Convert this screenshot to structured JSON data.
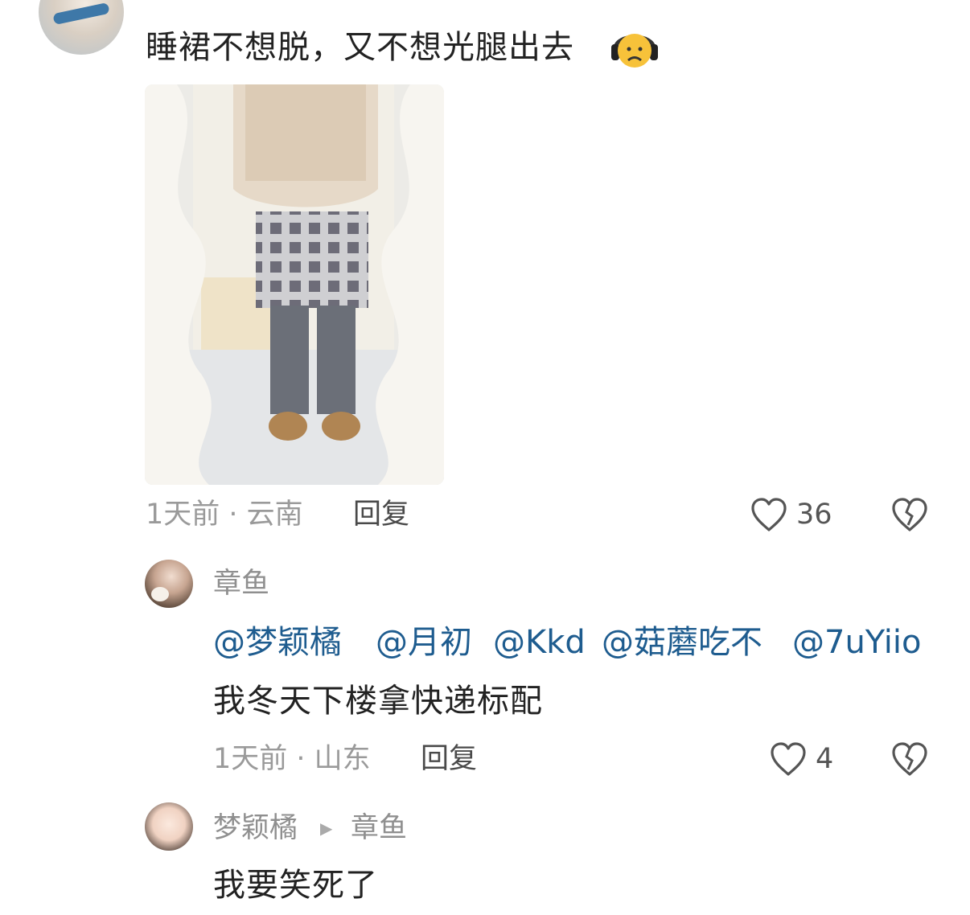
{
  "comments": {
    "top": {
      "text": "睡裙不想脱，又不想光腿出去",
      "emoji": "sad-face-headphones-emoji",
      "meta": "1天前 · 云南",
      "reply_label": "回复",
      "likes": "36"
    },
    "reply1": {
      "username": "章鱼",
      "mentions": [
        "@梦颖橘",
        "@月初",
        "@Kkd",
        "@菇蘑吃不",
        "@7uYiio"
      ],
      "text": "我冬天下楼拿快递标配",
      "meta": "1天前 · 山东",
      "reply_label": "回复",
      "likes": "4"
    },
    "reply2": {
      "username": "梦颖橘",
      "reply_to": "章鱼",
      "text": "我要笑死了"
    }
  },
  "icons": {
    "like": "heart-outline-icon",
    "dislike": "broken-heart-icon",
    "reply_arrow": "triangle-right-icon"
  },
  "colors": {
    "mention": "#1e5c8f",
    "meta": "#9a9a9a",
    "text": "#222222"
  }
}
